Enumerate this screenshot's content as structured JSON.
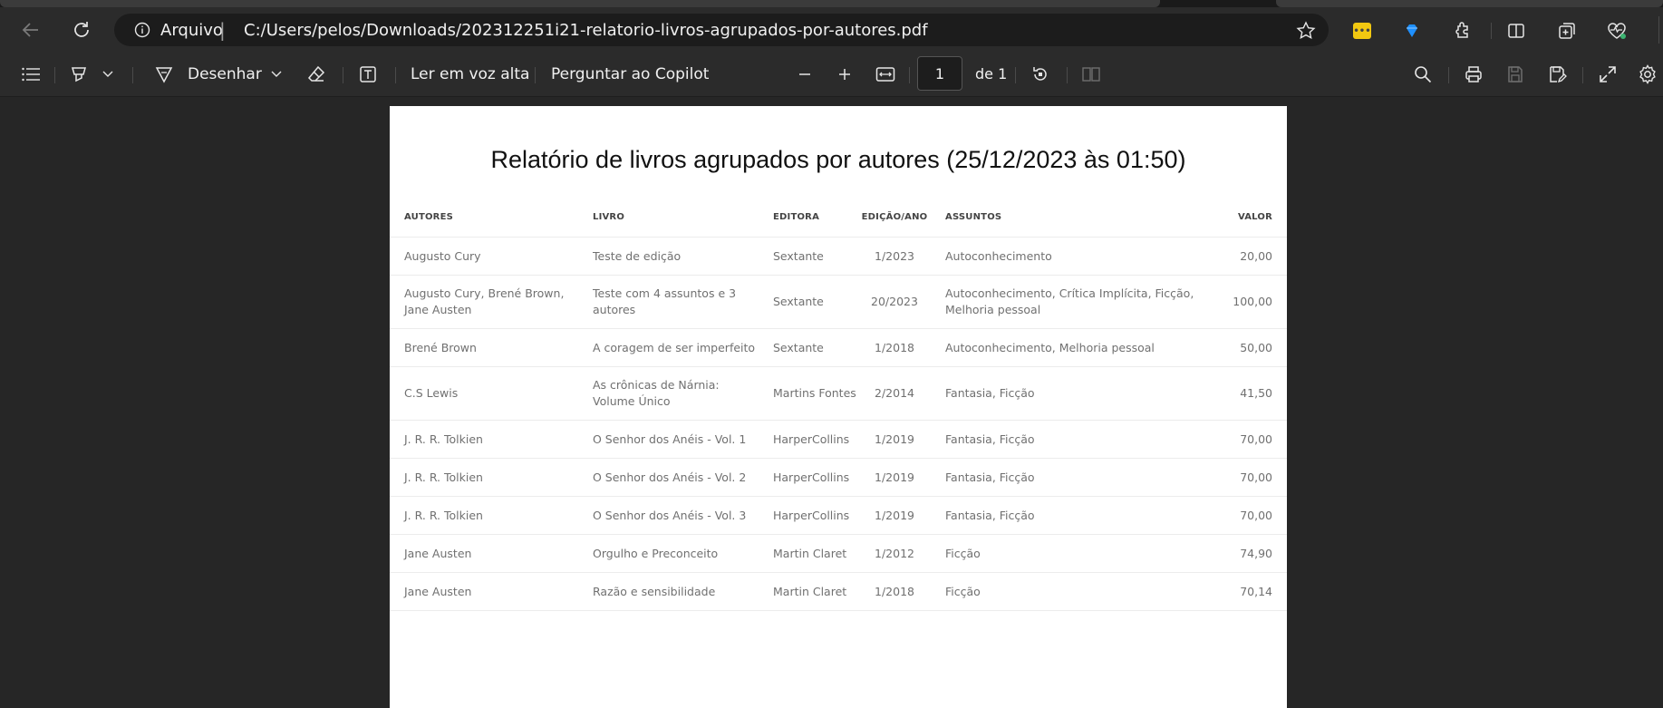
{
  "browser": {
    "scheme_label": "Arquivo",
    "separator": "|",
    "url": "C:/Users/pelos/Downloads/202312251i21-relatorio-livros-agrupados-por-autores.pdf"
  },
  "toolbar": {
    "draw_label": "Desenhar",
    "read_aloud_label": "Ler em voz alta",
    "copilot_label": "Perguntar ao Copilot",
    "page_number": "1",
    "page_total": "de 1"
  },
  "document": {
    "title": "Relatório de livros agrupados por autores (25/12/2023 às 01:50)",
    "headers": [
      "AUTORES",
      "LIVRO",
      "EDITORA",
      "EDIÇÃO/ANO",
      "ASSUNTOS",
      "VALOR"
    ],
    "rows": [
      {
        "autores": "Augusto Cury",
        "livro": "Teste de edição",
        "editora": "Sextante",
        "edicao": "1/2023",
        "assuntos": "Autoconhecimento",
        "valor": "20,00"
      },
      {
        "autores": "Augusto Cury, Brené Brown, Jane Austen",
        "livro": "Teste com 4 assuntos e 3 autores",
        "editora": "Sextante",
        "edicao": "20/2023",
        "assuntos": "Autoconhecimento, Crítica Implícita, Ficção, Melhoria pessoal",
        "valor": "100,00"
      },
      {
        "autores": "Brené Brown",
        "livro": "A coragem de ser imperfeito",
        "editora": "Sextante",
        "edicao": "1/2018",
        "assuntos": "Autoconhecimento, Melhoria pessoal",
        "valor": "50,00"
      },
      {
        "autores": "C.S Lewis",
        "livro": "As crônicas de Nárnia: Volume Único",
        "editora": "Martins Fontes",
        "edicao": "2/2014",
        "assuntos": "Fantasia, Ficção",
        "valor": "41,50"
      },
      {
        "autores": "J. R. R. Tolkien",
        "livro": "O Senhor dos Anéis - Vol. 1",
        "editora": "HarperCollins",
        "edicao": "1/2019",
        "assuntos": "Fantasia, Ficção",
        "valor": "70,00"
      },
      {
        "autores": "J. R. R. Tolkien",
        "livro": "O Senhor dos Anéis - Vol. 2",
        "editora": "HarperCollins",
        "edicao": "1/2019",
        "assuntos": "Fantasia, Ficção",
        "valor": "70,00"
      },
      {
        "autores": "J. R. R. Tolkien",
        "livro": "O Senhor dos Anéis - Vol. 3",
        "editora": "HarperCollins",
        "edicao": "1/2019",
        "assuntos": "Fantasia, Ficção",
        "valor": "70,00"
      },
      {
        "autores": "Jane Austen",
        "livro": "Orgulho e Preconceito",
        "editora": "Martin Claret",
        "edicao": "1/2012",
        "assuntos": "Ficção",
        "valor": "74,90"
      },
      {
        "autores": "Jane Austen",
        "livro": "Razão e sensibilidade",
        "editora": "Martin Claret",
        "edicao": "1/2018",
        "assuntos": "Ficção",
        "valor": "70,14"
      }
    ]
  },
  "icons": {
    "back": "arrow-left-icon",
    "reload": "reload-icon",
    "info": "info-icon",
    "star": "star-icon",
    "ext_yellow": "yellow-extension-icon",
    "ext_gem": "gem-extension-icon",
    "extensions": "puzzle-icon",
    "split": "split-screen-icon",
    "collections": "collections-icon",
    "health": "browser-essentials-icon"
  },
  "colors": {
    "page_bg": "#262626",
    "chrome": "#2b2b2b",
    "paper": "#ffffff",
    "accent_yellow": "#f2c811",
    "accent_blue": "#1e90ff",
    "status_green": "#3cb371"
  }
}
